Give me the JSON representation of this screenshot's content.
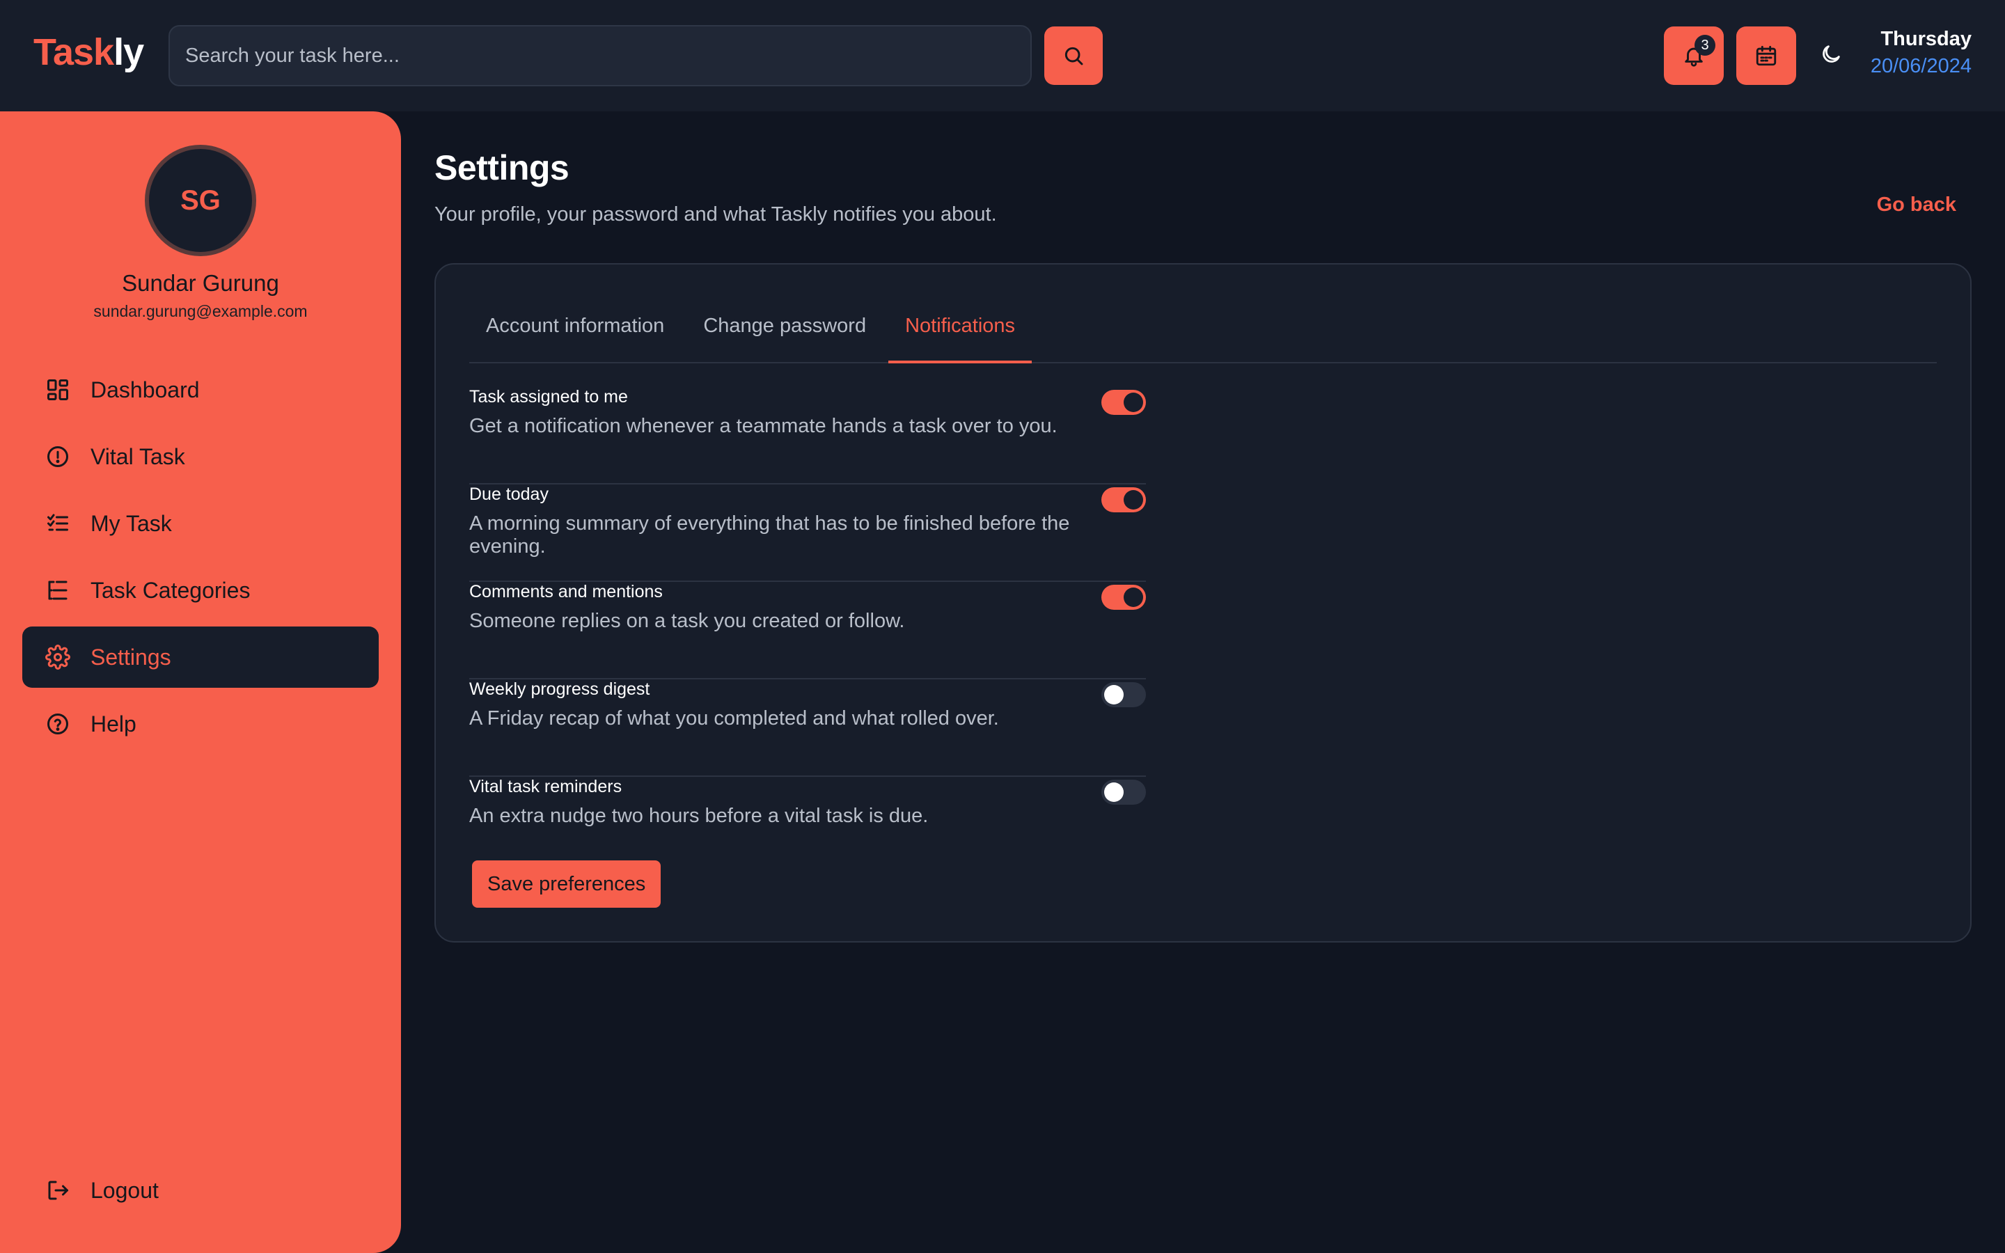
{
  "header": {
    "logo_part1": "Task",
    "logo_part2": "ly",
    "search_placeholder": "Search your task here...",
    "notification_count": "3",
    "day": "Thursday",
    "date": "20/06/2024"
  },
  "sidebar": {
    "avatar_initials": "SG",
    "user_name": "Sundar Gurung",
    "user_email": "sundar.gurung@example.com",
    "items": [
      {
        "label": "Dashboard",
        "icon": "dashboard-icon"
      },
      {
        "label": "Vital Task",
        "icon": "alert-circle-icon"
      },
      {
        "label": "My Task",
        "icon": "checklist-icon"
      },
      {
        "label": "Task Categories",
        "icon": "categories-icon"
      },
      {
        "label": "Settings",
        "icon": "gear-icon",
        "active": true
      },
      {
        "label": "Help",
        "icon": "help-icon"
      }
    ],
    "logout_label": "Logout"
  },
  "main": {
    "title": "Settings",
    "subtitle": "Your profile, your password and what Taskly notifies you about.",
    "go_back": "Go back",
    "tabs": [
      {
        "label": "Account information"
      },
      {
        "label": "Change password"
      },
      {
        "label": "Notifications",
        "active": true
      }
    ],
    "notifications": [
      {
        "title": "Task assigned to me",
        "desc": "Get a notification whenever a teammate hands a task over to you.",
        "enabled": true
      },
      {
        "title": "Due today",
        "desc": "A morning summary of everything that has to be finished before the evening.",
        "enabled": true
      },
      {
        "title": "Comments and mentions",
        "desc": "Someone replies on a task you created or follow.",
        "enabled": true
      },
      {
        "title": "Weekly progress digest",
        "desc": "A Friday recap of what you completed and what rolled over.",
        "enabled": false
      },
      {
        "title": "Vital task reminders",
        "desc": "An extra nudge two hours before a vital task is due.",
        "enabled": false
      }
    ],
    "save_label": "Save preferences"
  },
  "colors": {
    "accent": "#f75f4c",
    "background": "#101521",
    "surface": "#171d2a",
    "date_blue": "#4a8ff5"
  }
}
